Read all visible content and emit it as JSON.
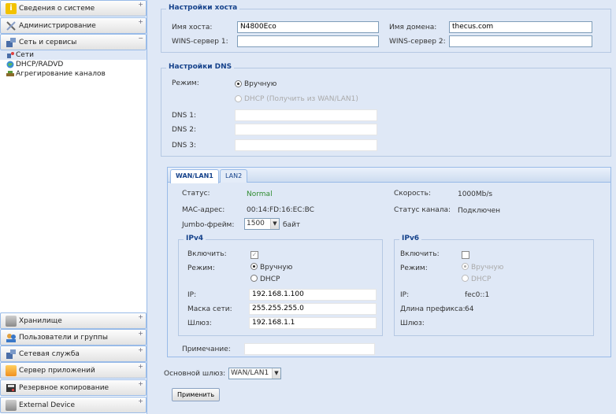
{
  "sidebar": {
    "top_headers": [
      {
        "label": "Сведения о системе",
        "icon": "info-icon",
        "color": "#e8b400"
      },
      {
        "label": "Администрирование",
        "icon": "tools-icon",
        "color": "#6a8fbf"
      },
      {
        "label": "Сеть и сервисы",
        "icon": "network-icon",
        "color": "#4a6ea8"
      }
    ],
    "tree": [
      {
        "label": "Сети",
        "icon": "network-node-icon"
      },
      {
        "label": "DHCP/RADVD",
        "icon": "globe-icon"
      },
      {
        "label": "Агрегирование каналов",
        "icon": "link-aggregation-icon"
      }
    ],
    "bottom_headers": [
      {
        "label": "Хранилище",
        "icon": "storage-icon"
      },
      {
        "label": "Пользователи и группы",
        "icon": "users-icon"
      },
      {
        "label": "Сетевая служба",
        "icon": "network-service-icon"
      },
      {
        "label": "Сервер приложений",
        "icon": "app-server-icon"
      },
      {
        "label": "Резервное копирование",
        "icon": "backup-icon"
      },
      {
        "label": "External Device",
        "icon": "external-device-icon"
      }
    ]
  },
  "host": {
    "legend": "Настройки хоста",
    "hostname_label": "Имя хоста:",
    "hostname_value": "N4800Eco",
    "domain_label": "Имя домена:",
    "domain_value": "thecus.com",
    "wins1_label": "WINS-сервер 1:",
    "wins1_value": "",
    "wins2_label": "WINS-сервер 2:",
    "wins2_value": ""
  },
  "dns": {
    "legend": "Настройки DNS",
    "mode_label": "Режим:",
    "manual_label": "Вручную",
    "dhcp_label": "DHCP (Получить из WAN/LAN1)",
    "dns1_label": "DNS 1:",
    "dns2_label": "DNS 2:",
    "dns3_label": "DNS 3:"
  },
  "tabs": [
    "WAN/LAN1",
    "LAN2"
  ],
  "wan": {
    "status_label": "Статус:",
    "status_value": "Normal",
    "status_color": "#2e8b2e",
    "speed_label": "Скорость:",
    "speed_value": "1000Mb/s",
    "mac_label": "MAC-адрес:",
    "mac_value": "00:14:FD:16:EC:BC",
    "link_label": "Статус канала:",
    "link_value": "Подключен",
    "jumbo_label": "Jumbo-фрейм:",
    "jumbo_value": "1500",
    "jumbo_unit": "байт",
    "ipv4": {
      "legend": "IPv4",
      "enable_label": "Включить:",
      "mode_label": "Режим:",
      "manual_label": "Вручную",
      "dhcp_label": "DHCP",
      "ip_label": "IP:",
      "ip_value": "192.168.1.100",
      "mask_label": "Маска сети:",
      "mask_value": "255.255.255.0",
      "gw_label": "Шлюз:",
      "gw_value": "192.168.1.1"
    },
    "ipv6": {
      "legend": "IPv6",
      "enable_label": "Включить:",
      "mode_label": "Режим:",
      "manual_label": "Вручную",
      "dhcp_label": "DHCP",
      "ip_label": "IP:",
      "ip_value": "fec0::1",
      "prefix_label": "Длина префикса:",
      "prefix_value": "64",
      "gw_label": "Шлюз:"
    },
    "note_label": "Примечание:"
  },
  "gateway": {
    "label": "Основной шлюз:",
    "value": "WAN/LAN1"
  },
  "apply_label": "Применить"
}
